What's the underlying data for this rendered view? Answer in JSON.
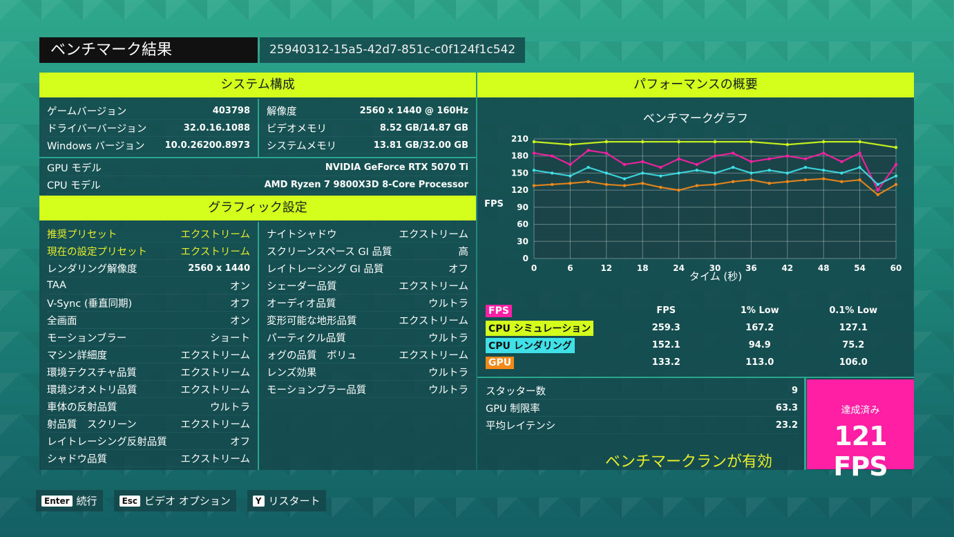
{
  "title": "ベンチマーク結果",
  "run_id": "25940312-15a5-42d7-851c-c0f124f1c542",
  "system": {
    "header": "システム構成",
    "left": [
      {
        "label": "ゲームバージョン",
        "value": "403798"
      },
      {
        "label": "ドライバーバージョン",
        "value": "32.0.16.1088"
      },
      {
        "label": "Windows バージョン",
        "value": "10.0.26200.8973"
      }
    ],
    "right": [
      {
        "label": "解像度",
        "value": "2560 x 1440 @ 160Hz"
      },
      {
        "label": "ビデオメモリ",
        "value": "8.52 GB/14.87 GB"
      },
      {
        "label": "システムメモリ",
        "value": "13.81 GB/32.00 GB"
      }
    ],
    "gpu": {
      "label": "GPU モデル",
      "value": "NVIDIA GeForce RTX 5070 Ti"
    },
    "cpu": {
      "label": "CPU モデル",
      "value": "AMD Ryzen 7 9800X3D 8-Core Processor"
    }
  },
  "graphics": {
    "header": "グラフィック設定",
    "left": [
      {
        "label": "推奨プリセット",
        "value": "エクストリーム"
      },
      {
        "label": "現在の設定プリセット",
        "value": "エクストリーム"
      },
      {
        "label": "レンダリング解像度",
        "value": "2560 x 1440"
      },
      {
        "label": "TAA",
        "value": "オン"
      },
      {
        "label": "V-Sync (垂直同期)",
        "value": "オフ"
      },
      {
        "label": "全画面",
        "value": "オン"
      },
      {
        "label": "モーションブラー",
        "value": "ショート"
      },
      {
        "label": "マシン詳細度",
        "value": "エクストリーム"
      },
      {
        "label": "環境テクスチャ品質",
        "value": "エクストリーム"
      },
      {
        "label": "環境ジオメトリ品質",
        "value": "エクストリーム"
      },
      {
        "label": "車体の反射品質",
        "value": "ウルトラ"
      },
      {
        "label": "射品質　スクリーン",
        "value": "エクストリーム"
      },
      {
        "label": "レイトレーシング反射品質",
        "value": "オフ"
      },
      {
        "label": "シャドウ品質",
        "value": "エクストリーム"
      }
    ],
    "right": [
      {
        "label": "ナイトシャドウ",
        "value": "エクストリーム"
      },
      {
        "label": "スクリーンスペース GI 品質",
        "value": "高"
      },
      {
        "label": "レイトレーシング GI 品質",
        "value": "オフ"
      },
      {
        "label": "シェーダー品質",
        "value": "エクストリーム"
      },
      {
        "label": "オーディオ品質",
        "value": "ウルトラ"
      },
      {
        "label": "変形可能な地形品質",
        "value": "エクストリーム"
      },
      {
        "label": "パーティクル品質",
        "value": "ウルトラ"
      },
      {
        "label": "ォグの品質　ボリュ",
        "value": "エクストリーム"
      },
      {
        "label": "レンズ効果",
        "value": "ウルトラ"
      },
      {
        "label": "モーションブラー品質",
        "value": "ウルトラ"
      }
    ]
  },
  "performance": {
    "header": "パフォーマンスの概要",
    "legend": {
      "columns": [
        "FPS",
        "1% Low",
        "0.1% Low"
      ],
      "rows": [
        {
          "name": "FPS",
          "color": "#ff1fa4",
          "values": [
            "",
            "",
            ""
          ]
        },
        {
          "name": "CPU シミュレーション",
          "color": "#d4ff1c",
          "values": [
            "259.3",
            "167.2",
            "127.1"
          ]
        },
        {
          "name": "CPU レンダリング",
          "color": "#3fe0e8",
          "values": [
            "152.1",
            "94.9",
            "75.2"
          ]
        },
        {
          "name": "GPU",
          "color": "#f28a1a",
          "values": [
            "133.2",
            "113.0",
            "106.0"
          ]
        }
      ]
    },
    "stats": [
      {
        "label": "スタッター数",
        "value": "9"
      },
      {
        "label": "GPU 制限率",
        "value": "63.3"
      },
      {
        "label": "平均レイテンシ",
        "value": "23.2"
      }
    ],
    "achieved_label": "達成済み",
    "achieved_value": "121 FPS",
    "enabled_text": "ベンチマークランが有効"
  },
  "chart_data": {
    "type": "scatter",
    "title": "ベンチマークグラフ",
    "xlabel": "タイム (秒)",
    "ylabel": "FPS",
    "xlim": [
      0,
      60
    ],
    "ylim": [
      0,
      210
    ],
    "x_ticks": [
      0,
      6,
      12,
      18,
      24,
      30,
      36,
      42,
      48,
      54,
      60
    ],
    "y_ticks": [
      0,
      30,
      60,
      90,
      120,
      150,
      180,
      210
    ],
    "grid": true,
    "series": [
      {
        "name": "CPU シミュレーション",
        "color": "#d4ff1c",
        "x": [
          0,
          6,
          12,
          18,
          24,
          30,
          36,
          42,
          48,
          54,
          60
        ],
        "values": [
          205,
          200,
          205,
          205,
          205,
          205,
          205,
          200,
          205,
          205,
          195
        ]
      },
      {
        "name": "FPS",
        "color": "#ff1fa4",
        "x": [
          0,
          3,
          6,
          9,
          12,
          15,
          18,
          21,
          24,
          27,
          30,
          33,
          36,
          39,
          42,
          45,
          48,
          51,
          54,
          57,
          60
        ],
        "values": [
          185,
          180,
          165,
          190,
          185,
          165,
          170,
          160,
          175,
          165,
          180,
          185,
          170,
          175,
          180,
          175,
          185,
          170,
          185,
          120,
          165
        ]
      },
      {
        "name": "CPU レンダリング",
        "color": "#3fe0e8",
        "x": [
          0,
          3,
          6,
          9,
          12,
          15,
          18,
          21,
          24,
          27,
          30,
          33,
          36,
          39,
          42,
          45,
          48,
          51,
          54,
          57,
          60
        ],
        "values": [
          155,
          150,
          145,
          160,
          150,
          140,
          150,
          145,
          150,
          155,
          150,
          160,
          150,
          155,
          150,
          160,
          155,
          150,
          160,
          130,
          145
        ]
      },
      {
        "name": "GPU",
        "color": "#f28a1a",
        "x": [
          0,
          3,
          6,
          9,
          12,
          15,
          18,
          21,
          24,
          27,
          30,
          33,
          36,
          39,
          42,
          45,
          48,
          51,
          54,
          57,
          60
        ],
        "values": [
          128,
          130,
          132,
          135,
          130,
          128,
          132,
          125,
          120,
          128,
          130,
          135,
          138,
          132,
          135,
          138,
          140,
          135,
          138,
          112,
          130
        ]
      }
    ]
  },
  "footer": [
    {
      "key": "Enter",
      "label": "続行"
    },
    {
      "key": "Esc",
      "label": "ビデオ オプション"
    },
    {
      "key": "Y",
      "label": "リスタート"
    }
  ]
}
